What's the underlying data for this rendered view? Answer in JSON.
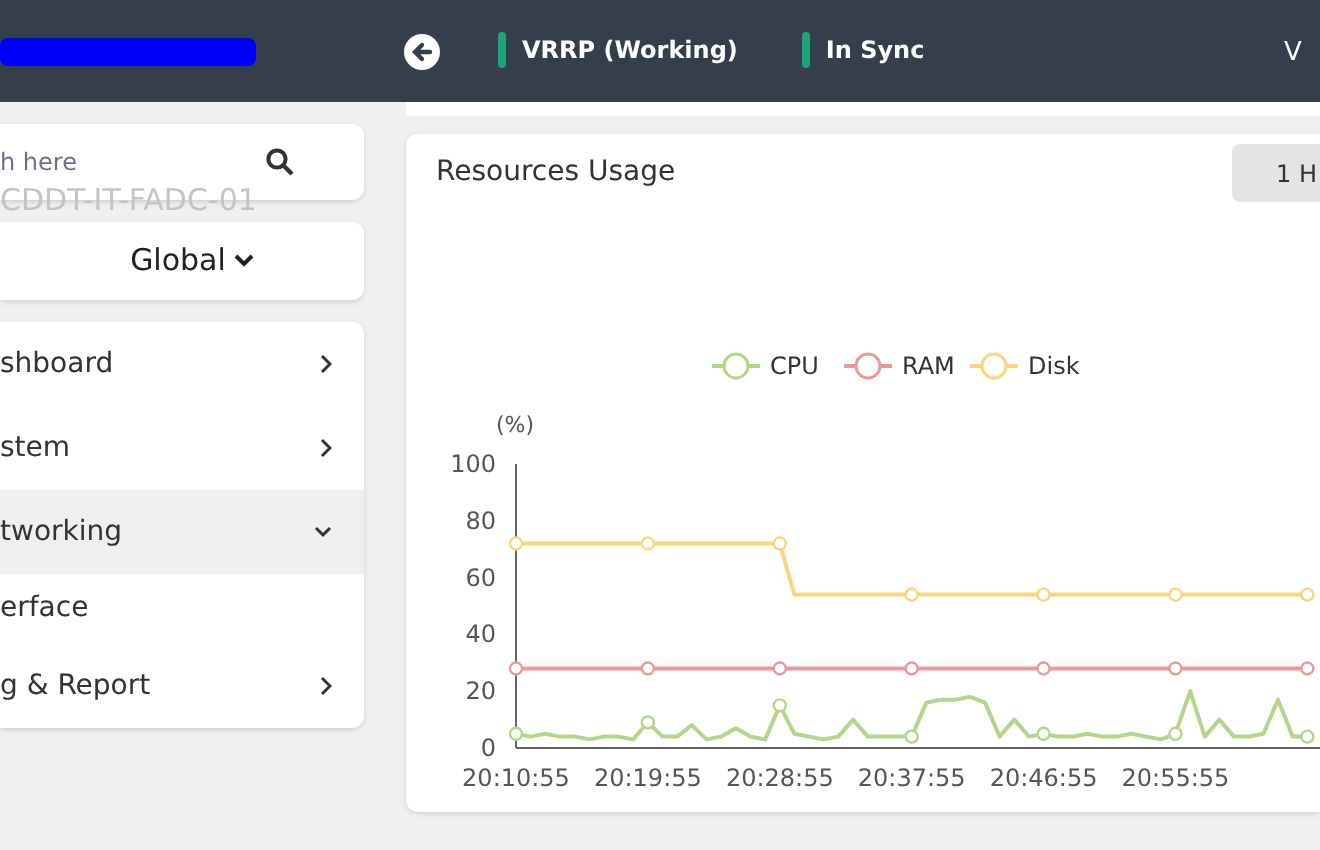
{
  "header": {
    "statuses": [
      {
        "label": "VRRP (Working)",
        "color": "#1aa57a"
      },
      {
        "label": "In Sync",
        "color": "#1aa57a"
      }
    ],
    "version": "V"
  },
  "sidebar": {
    "search": {
      "placeholder": "h here",
      "ghost_text": "CDDT-IT-FADC-01"
    },
    "scope": {
      "label": "Global"
    },
    "menu": [
      {
        "label": "shboard",
        "expanded": false
      },
      {
        "label": "stem",
        "expanded": false
      },
      {
        "label": "tworking",
        "expanded": true,
        "children": [
          {
            "label": "erface"
          }
        ]
      },
      {
        "label": "g & Report",
        "expanded": false
      }
    ]
  },
  "resources": {
    "title": "Resources Usage",
    "range_button": "1 H",
    "chart_data": {
      "type": "line",
      "ylabel": "(%)",
      "categories": [
        "20:10:55",
        null,
        null,
        null,
        null,
        null,
        null,
        null,
        null,
        "20:19:55",
        null,
        null,
        null,
        null,
        null,
        null,
        null,
        null,
        "20:28:55",
        null,
        null,
        null,
        null,
        null,
        null,
        null,
        null,
        "20:37:55",
        null,
        null,
        null,
        null,
        null,
        null,
        null,
        null,
        "20:46:55",
        null,
        null,
        null,
        null,
        null,
        null,
        null,
        null,
        "20:55:55",
        null,
        null,
        null,
        null,
        null,
        null,
        null,
        null,
        null
      ],
      "legend": "top",
      "ylim": [
        0,
        100
      ],
      "yticks": [
        0,
        20,
        40,
        60,
        80,
        100
      ],
      "series": [
        {
          "name": "CPU",
          "color": "#b5d68a",
          "values": [
            5,
            4,
            5,
            4,
            4,
            3,
            4,
            4,
            3,
            9,
            4,
            4,
            8,
            3,
            4,
            7,
            4,
            3,
            15,
            5,
            4,
            3,
            4,
            10,
            4,
            4,
            4,
            4,
            16,
            17,
            17,
            18,
            16,
            4,
            10,
            4,
            5,
            4,
            4,
            5,
            4,
            4,
            5,
            4,
            3,
            5,
            20,
            4,
            10,
            4,
            4,
            5,
            17,
            4,
            4
          ]
        },
        {
          "name": "RAM",
          "color": "#e89a9a",
          "values": [
            28,
            28,
            28,
            28,
            28,
            28,
            28,
            28,
            28,
            28,
            28,
            28,
            28,
            28,
            28,
            28,
            28,
            28,
            28,
            28,
            28,
            28,
            28,
            28,
            28,
            28,
            28,
            28,
            28,
            28,
            28,
            28,
            28,
            28,
            28,
            28,
            28,
            28,
            28,
            28,
            28,
            28,
            28,
            28,
            28,
            28,
            28,
            28,
            28,
            28,
            28,
            28,
            28,
            28,
            28
          ]
        },
        {
          "name": "Disk",
          "color": "#f7d77a",
          "values": [
            72,
            72,
            72,
            72,
            72,
            72,
            72,
            72,
            72,
            72,
            72,
            72,
            72,
            72,
            72,
            72,
            72,
            72,
            72,
            54,
            54,
            54,
            54,
            54,
            54,
            54,
            54,
            54,
            54,
            54,
            54,
            54,
            54,
            54,
            54,
            54,
            54,
            54,
            54,
            54,
            54,
            54,
            54,
            54,
            54,
            54,
            54,
            54,
            54,
            54,
            54,
            54,
            54,
            54,
            54
          ]
        }
      ]
    }
  }
}
